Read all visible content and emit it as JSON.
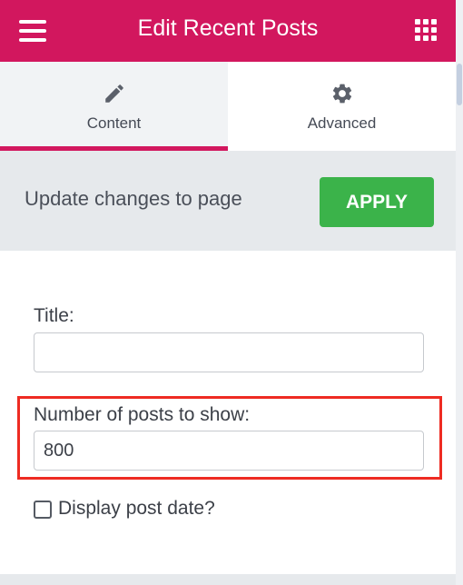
{
  "header": {
    "title": "Edit Recent Posts",
    "menu_icon": "hamburger-menu-icon",
    "apps_icon": "grid-apps-icon",
    "background_color": "#d2175e"
  },
  "tabs": [
    {
      "label": "Content",
      "icon": "pencil-icon",
      "active": true
    },
    {
      "label": "Advanced",
      "icon": "gear-icon",
      "active": false
    }
  ],
  "apply_bar": {
    "text": "Update changes to page",
    "button_label": "APPLY",
    "button_color": "#3bb34a"
  },
  "form": {
    "title_label": "Title:",
    "title_value": "",
    "posts_label": "Number of posts to show:",
    "posts_value": "800",
    "display_date_label": "Display post date?",
    "display_date_checked": false,
    "highlight_color": "#ee2b22"
  }
}
